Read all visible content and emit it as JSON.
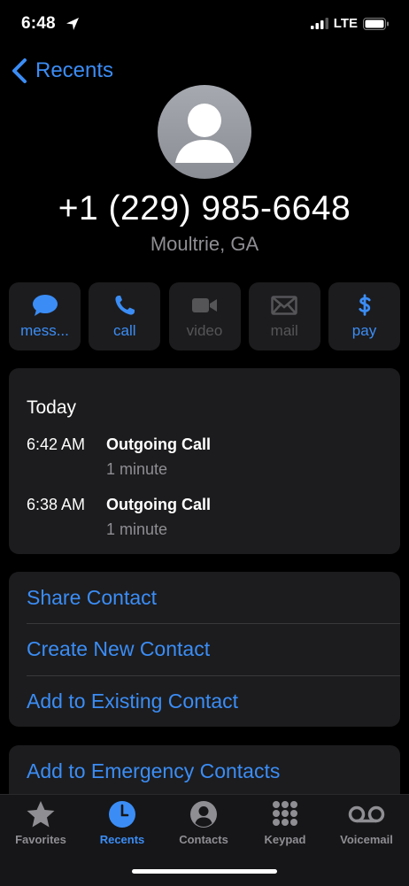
{
  "status_bar": {
    "time": "6:48",
    "network": "LTE"
  },
  "nav": {
    "back_label": "Recents"
  },
  "contact": {
    "number": "+1 (229) 985-6648",
    "location": "Moultrie, GA"
  },
  "actions": [
    {
      "label": "mess...",
      "icon": "message-icon",
      "enabled": true
    },
    {
      "label": "call",
      "icon": "phone-icon",
      "enabled": true
    },
    {
      "label": "video",
      "icon": "video-icon",
      "enabled": false
    },
    {
      "label": "mail",
      "icon": "mail-icon",
      "enabled": false
    },
    {
      "label": "pay",
      "icon": "dollar-icon",
      "enabled": true
    }
  ],
  "history": {
    "day": "Today",
    "calls": [
      {
        "time": "6:42 AM",
        "type": "Outgoing Call",
        "duration": "1 minute"
      },
      {
        "time": "6:38 AM",
        "type": "Outgoing Call",
        "duration": "1 minute"
      }
    ]
  },
  "options": [
    "Share Contact",
    "Create New Contact",
    "Add to Existing Contact"
  ],
  "emergency": "Add to Emergency Contacts",
  "tabs": [
    {
      "label": "Favorites",
      "icon": "star-icon"
    },
    {
      "label": "Recents",
      "icon": "clock-icon"
    },
    {
      "label": "Contacts",
      "icon": "person-circle-icon"
    },
    {
      "label": "Keypad",
      "icon": "keypad-icon"
    },
    {
      "label": "Voicemail",
      "icon": "voicemail-icon"
    }
  ],
  "colors": {
    "accent": "#3b8df5",
    "card": "#1c1c1e",
    "secondary_text": "#8e8e93"
  }
}
